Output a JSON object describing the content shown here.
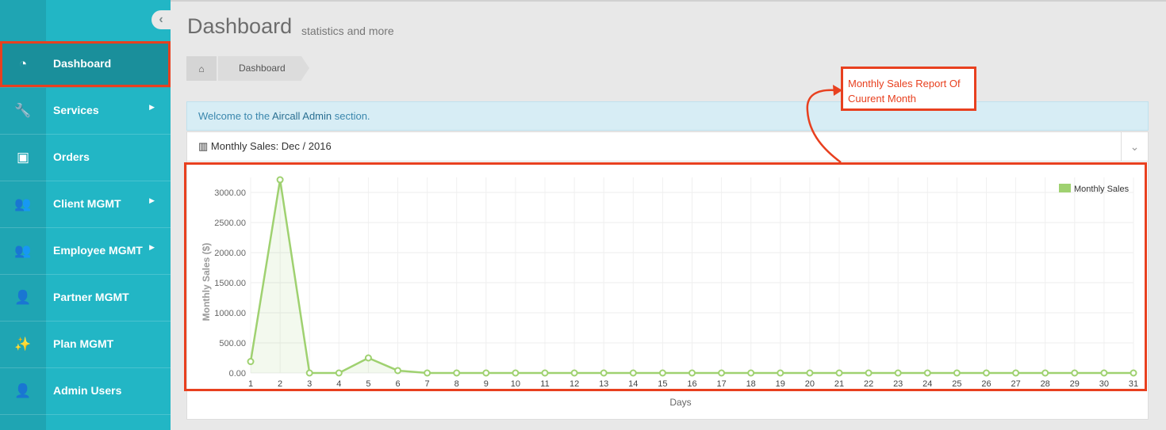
{
  "sidebar": {
    "collapse_icon": "chevron-left-icon",
    "items": [
      {
        "label": "Dashboard",
        "icon": "dashboard-icon",
        "glyph": "◔",
        "submenu": false
      },
      {
        "label": "Services",
        "icon": "wrench-icon",
        "glyph": "🔧",
        "submenu": true
      },
      {
        "label": "Orders",
        "icon": "money-icon",
        "glyph": "▣",
        "submenu": false
      },
      {
        "label": "Client MGMT",
        "icon": "users-icon",
        "glyph": "👥",
        "submenu": true
      },
      {
        "label": "Employee MGMT",
        "icon": "users-icon",
        "glyph": "👥",
        "submenu": true
      },
      {
        "label": "Partner MGMT",
        "icon": "user-icon",
        "glyph": "👤",
        "submenu": false
      },
      {
        "label": "Plan MGMT",
        "icon": "magic-wand-icon",
        "glyph": "✨",
        "submenu": false
      },
      {
        "label": "Admin Users",
        "icon": "user-icon",
        "glyph": "👤",
        "submenu": false
      }
    ]
  },
  "header": {
    "title": "Dashboard",
    "subtitle": "statistics and more"
  },
  "breadcrumb": {
    "home_icon": "home-icon",
    "current": "Dashboard"
  },
  "welcome": {
    "prefix": "Welcome to the ",
    "highlight": "Aircall Admin",
    "suffix": " section."
  },
  "panel": {
    "title_icon": "bar-chart-icon",
    "title": "Monthly Sales: Dec / 2016",
    "collapse_icon": "chevron-down-icon"
  },
  "annotation": {
    "line1": "Monthly Sales Report Of",
    "line2": "Cuurent Month"
  },
  "colors": {
    "sidebar": "#22b6c5",
    "accent_red": "#e8401f",
    "line": "#9fd170"
  },
  "chart_data": {
    "type": "line",
    "xlabel": "Days",
    "ylabel": "Monthly Sales ($)",
    "x": [
      1,
      2,
      3,
      4,
      5,
      6,
      7,
      8,
      9,
      10,
      11,
      12,
      13,
      14,
      15,
      16,
      17,
      18,
      19,
      20,
      21,
      22,
      23,
      24,
      25,
      26,
      27,
      28,
      29,
      30,
      31
    ],
    "series": [
      {
        "name": "Monthly Sales",
        "values": [
          190,
          3210,
          0,
          0,
          250,
          40,
          0,
          0,
          0,
          0,
          0,
          0,
          0,
          0,
          0,
          0,
          0,
          0,
          0,
          0,
          0,
          0,
          0,
          0,
          0,
          0,
          0,
          0,
          0,
          0,
          0
        ]
      }
    ],
    "ylim": [
      0,
      3250
    ],
    "yticks": [
      "0.00",
      "500.00",
      "1000.00",
      "1500.00",
      "2000.00",
      "2500.00",
      "3000.00"
    ],
    "legend": "top-right",
    "grid": true
  }
}
